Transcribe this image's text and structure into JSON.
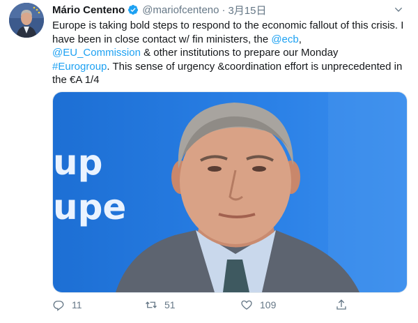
{
  "author": {
    "display_name": "Mário Centeno",
    "handle": "@mariofcenteno",
    "separator": "·",
    "time": "3月15日"
  },
  "tweet_text": {
    "part1": "Europe is taking bold steps to respond to the economic fallout of this crisis. I have been in close contact w/ fin ministers, the ",
    "mention_ecb": "@ecb",
    "part2": ", ",
    "mention_commission": "@EU_Commission",
    "part3": " & other institutions to prepare our Monday ",
    "hashtag": "#Eurogroup",
    "part4": ". This sense of urgency &coordination effort is unprecedented in the €A 1/4"
  },
  "media": {
    "backdrop_text_line1": "up",
    "backdrop_text_line2": "upe"
  },
  "actions": {
    "reply_count": "11",
    "retweet_count": "51",
    "like_count": "109"
  },
  "icons": {
    "verified": "verified-badge-icon",
    "more": "chevron-down-icon",
    "reply": "reply-icon",
    "retweet": "retweet-icon",
    "like": "heart-icon",
    "share": "share-icon"
  },
  "colors": {
    "link": "#1da1f2",
    "secondary_text": "#657786",
    "verified": "#1da1f2"
  }
}
